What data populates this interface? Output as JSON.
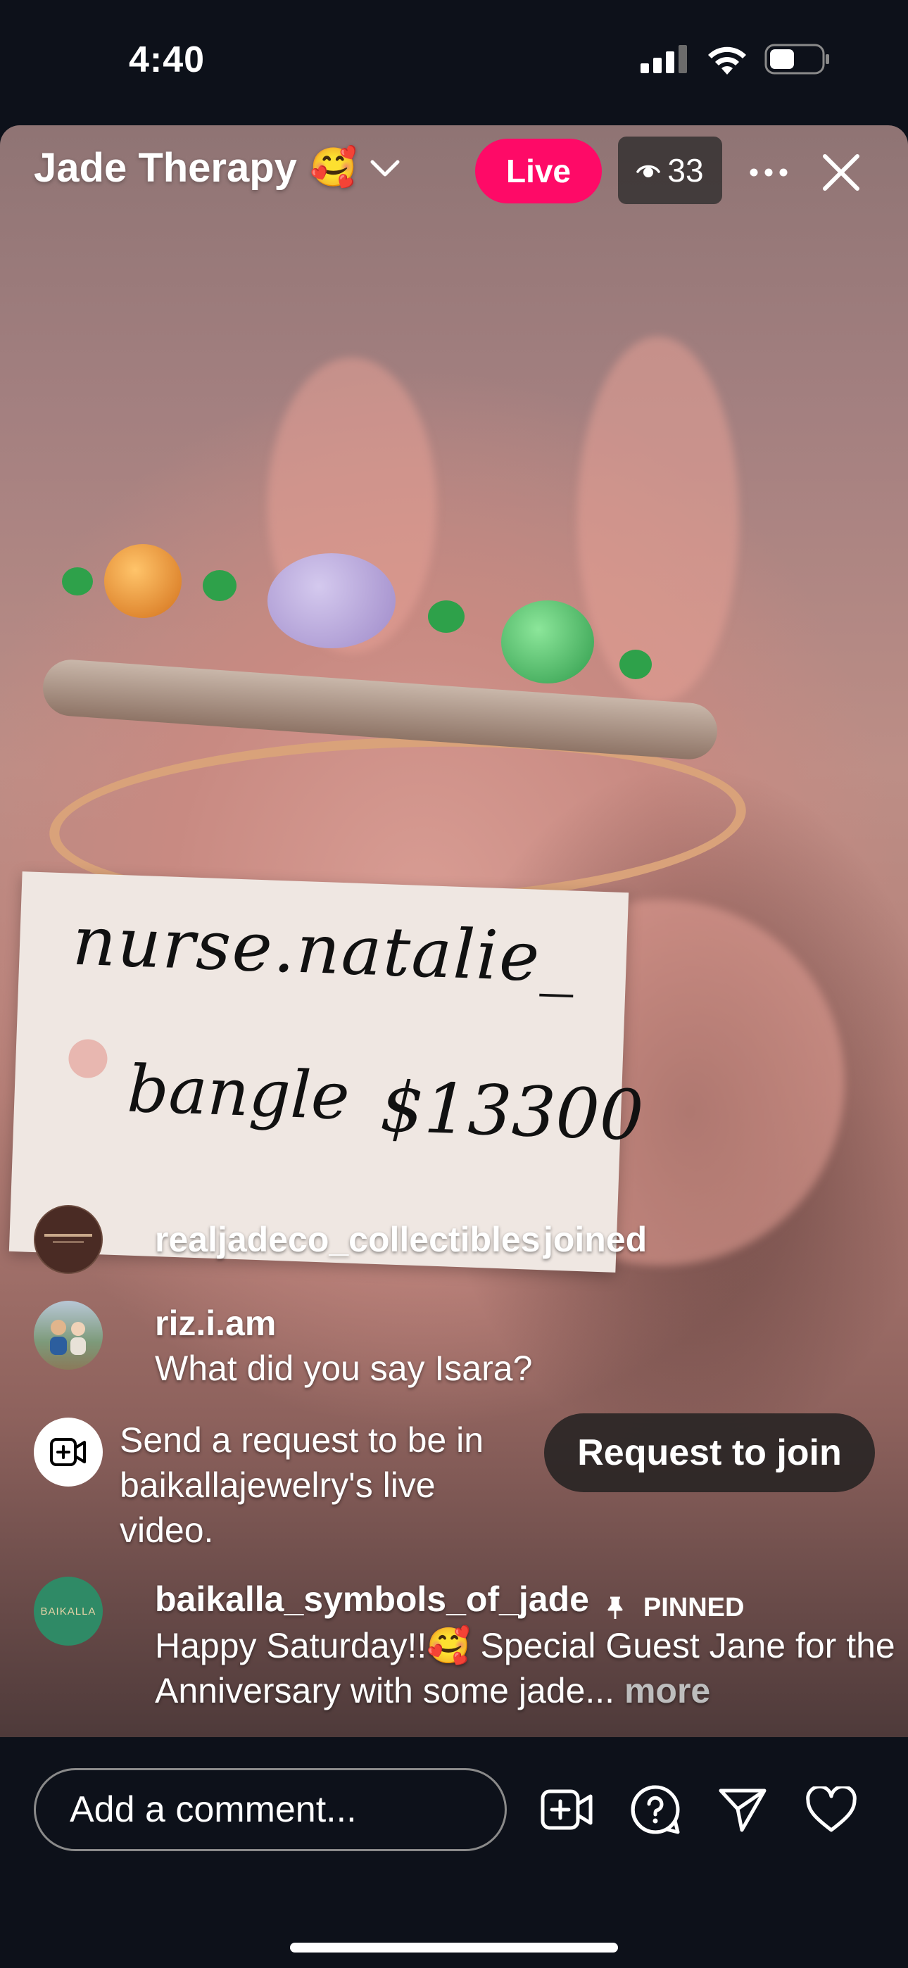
{
  "status_bar": {
    "time": "4:40"
  },
  "header": {
    "title": "Jade Therapy",
    "title_emoji": "🥰",
    "live_label": "Live",
    "viewer_count": "33"
  },
  "tag": {
    "line1": "nurse.natalie_",
    "line2_item": "bangle",
    "line2_price": "$13300"
  },
  "comments": [
    {
      "user": "realjadeco_collectibles",
      "text": "joined"
    },
    {
      "user": "riz.i.am",
      "text": "What did you say Isara?"
    }
  ],
  "join_request": {
    "text": "Send a request to be in baikallajewelry's live video.",
    "button_label": "Request to join"
  },
  "pinned_comment": {
    "user": "baikalla_symbols_of_jade",
    "pinned_label": "PINNED",
    "text": "Happy Saturday!!🥰 Special Guest Jane for the Anniversary with some jade...",
    "more_label": "more",
    "avatar_text": "BAIKALLA"
  },
  "footer": {
    "comment_placeholder": "Add a comment..."
  },
  "colors": {
    "live_badge": "#fe0a67",
    "background": "#0d111a"
  },
  "icons": [
    "signal-icon",
    "wifi-icon",
    "battery-icon",
    "chevron-down-icon",
    "eye-icon",
    "more-icon",
    "close-icon",
    "video-add-icon",
    "question-icon",
    "send-icon",
    "heart-icon",
    "pin-icon"
  ]
}
